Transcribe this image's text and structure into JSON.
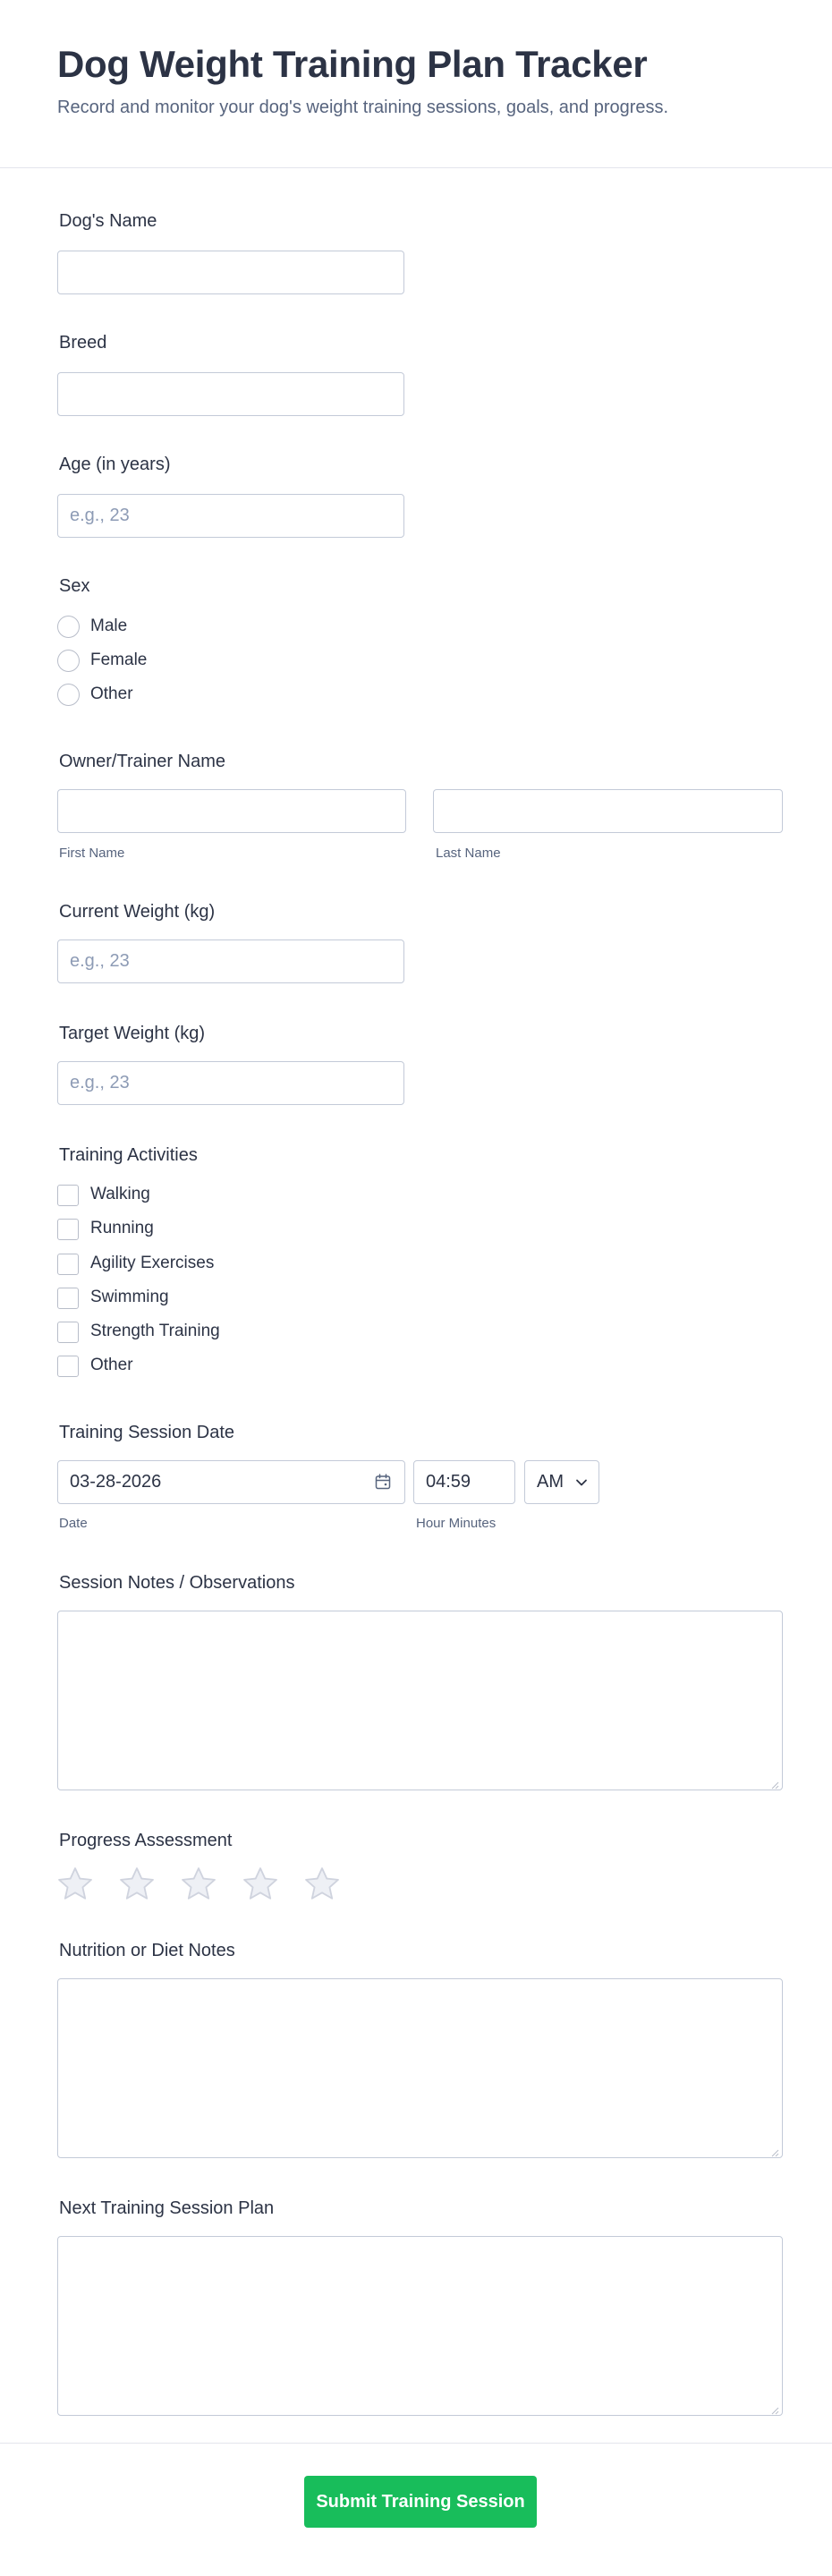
{
  "header": {
    "title": "Dog Weight Training Plan Tracker",
    "subtitle": "Record and monitor your dog's weight training sessions, goals, and progress."
  },
  "fields": {
    "dog_name": {
      "label": "Dog's Name",
      "value": ""
    },
    "breed": {
      "label": "Breed",
      "value": ""
    },
    "age": {
      "label": "Age (in years)",
      "placeholder": "e.g., 23"
    },
    "sex": {
      "label": "Sex",
      "options": [
        "Male",
        "Female",
        "Other"
      ]
    },
    "owner": {
      "label": "Owner/Trainer Name",
      "first_sublabel": "First Name",
      "last_sublabel": "Last Name"
    },
    "current_weight": {
      "label": "Current Weight (kg)",
      "placeholder": "e.g., 23"
    },
    "target_weight": {
      "label": "Target Weight (kg)",
      "placeholder": "e.g., 23"
    },
    "activities": {
      "label": "Training Activities",
      "options": [
        "Walking",
        "Running",
        "Agility Exercises",
        "Swimming",
        "Strength Training",
        "Other"
      ]
    },
    "session_date": {
      "label": "Training Session Date",
      "date_value": "03-28-2026",
      "date_sublabel": "Date",
      "time_value": "04:59",
      "time_sublabel": "Hour Minutes",
      "ampm_value": "AM"
    },
    "session_notes": {
      "label": "Session Notes / Observations"
    },
    "progress": {
      "label": "Progress Assessment",
      "max_stars": 5,
      "rating": 0
    },
    "nutrition": {
      "label": "Nutrition or Diet Notes"
    },
    "next_plan": {
      "label": "Next Training Session Plan"
    }
  },
  "submit_label": "Submit Training Session",
  "colors": {
    "accent": "#18bd5b",
    "text": "#2c3345",
    "muted": "#57647e",
    "border": "#c3cad8",
    "star": "#e3e5ec"
  }
}
